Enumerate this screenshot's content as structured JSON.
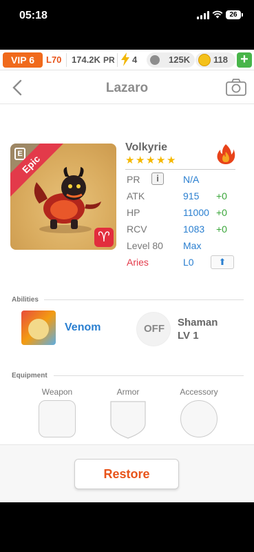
{
  "status_bar": {
    "time": "05:18",
    "battery": "26"
  },
  "resources": {
    "vip": "VIP 6",
    "level": "L70",
    "power": "174.2K",
    "power_suffix": "PR",
    "energy": "4",
    "paw_amount": "125K",
    "coins": "118",
    "add_label": "+"
  },
  "header": {
    "title": "Lazaro"
  },
  "monster": {
    "rarity": "Epic",
    "rarity_badge": "E",
    "sign_glyph": "♈",
    "name": "Volkyrie",
    "stars": 5,
    "element_icon": "fire-element-icon",
    "stats": [
      {
        "key": "PR",
        "value": "N/A",
        "delta": ""
      },
      {
        "key": "ATK",
        "value": "915",
        "delta": "+0"
      },
      {
        "key": "HP",
        "value": "11000",
        "delta": "+0"
      },
      {
        "key": "RCV",
        "value": "1083",
        "delta": "+0"
      },
      {
        "key": "Level 80",
        "value": "Max",
        "delta": ""
      },
      {
        "key": "Aries",
        "value": "L0",
        "delta": ""
      }
    ],
    "info_label": "i",
    "upgrade_label": "⬆"
  },
  "abilities": {
    "title": "Abilities",
    "primary": {
      "name": "Venom"
    },
    "secondary": {
      "status": "OFF",
      "name_line1": "Shaman",
      "name_line2": "LV 1"
    }
  },
  "equipment": {
    "title": "Equipment",
    "slots": [
      "Weapon",
      "Armor",
      "Accessory"
    ]
  },
  "footer": {
    "restore_label": "Restore"
  },
  "colors": {
    "accent": "#e8541a",
    "link_blue": "#2a7fd0",
    "positive_green": "#3aa63a",
    "rarity_red": "#e33a4a",
    "star_gold": "#f5b800"
  }
}
